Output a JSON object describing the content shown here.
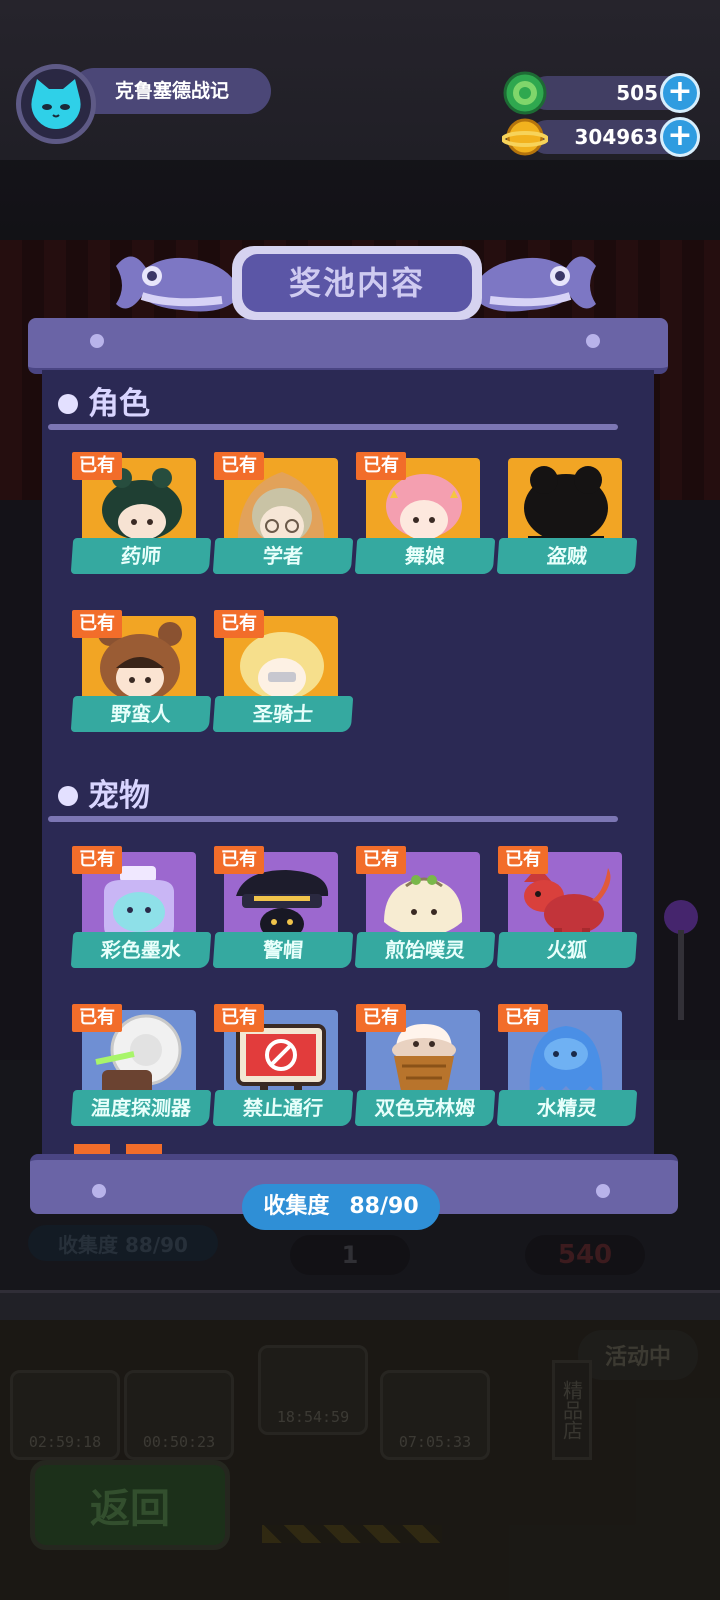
{
  "player": {
    "name": "克鲁塞德战记",
    "avatar_icon": "cat-face-icon"
  },
  "currencies": [
    {
      "icon": "green-gem-coin-icon",
      "value": "505",
      "color": "#2fa84f"
    },
    {
      "icon": "gold-planet-coin-icon",
      "value": "304963",
      "color": "#f2b21e"
    }
  ],
  "panel": {
    "title": "奖池内容",
    "owned_tag": "已有",
    "sections": [
      {
        "title": "角色",
        "items": [
          {
            "name": "药师",
            "owned": true,
            "icon": "pharmacist-character-icon"
          },
          {
            "name": "学者",
            "owned": true,
            "icon": "scholar-character-icon"
          },
          {
            "name": "舞娘",
            "owned": true,
            "icon": "dancer-character-icon"
          },
          {
            "name": "盗贼",
            "owned": false,
            "icon": "thief-silhouette-icon"
          },
          {
            "name": "野蛮人",
            "owned": true,
            "icon": "barbarian-character-icon"
          },
          {
            "name": "圣骑士",
            "owned": true,
            "icon": "paladin-character-icon"
          }
        ]
      },
      {
        "title": "宠物",
        "items": [
          {
            "name": "彩色墨水",
            "owned": true,
            "icon": "color-ink-pet-icon"
          },
          {
            "name": "警帽",
            "owned": true,
            "icon": "police-hat-pet-icon"
          },
          {
            "name": "煎饴噗灵",
            "owned": true,
            "icon": "dumpling-pet-icon"
          },
          {
            "name": "火狐",
            "owned": true,
            "icon": "fire-fox-pet-icon"
          },
          {
            "name": "温度探测器",
            "owned": true,
            "icon": "temperature-detector-pet-icon"
          },
          {
            "name": "禁止通行",
            "owned": true,
            "icon": "no-entry-sign-pet-icon"
          },
          {
            "name": "双色克林姆",
            "owned": true,
            "icon": "ice-cream-pet-icon"
          },
          {
            "name": "水精灵",
            "owned": true,
            "icon": "water-spirit-pet-icon"
          }
        ]
      }
    ],
    "collection": {
      "label": "收集度",
      "value": "88/90",
      "collected": 88,
      "total": 90
    }
  },
  "background": {
    "ghost_progress": "收集度  88/90",
    "ghost_count": "1",
    "ghost_price": "540",
    "slot_timers": [
      "02:59:18",
      "00:50:23",
      "18:54:59",
      "07:05:33"
    ],
    "side_sign": "精品店",
    "event_sign": "活动中",
    "back_button": "返回"
  },
  "colors": {
    "panel_body": "#2b2954",
    "label_teal": "#35a9a0",
    "owned_orange": "#f26d2a",
    "gold_card": "#f2a524",
    "purple_card": "#9c68cf",
    "blue_card": "#6f8fd3"
  }
}
